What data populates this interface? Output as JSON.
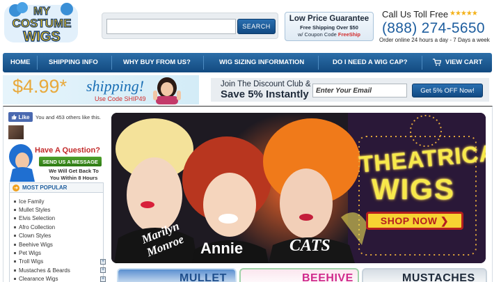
{
  "header": {
    "logo_line1": "MY",
    "logo_line2": "COSTUME",
    "logo_line3": "WIGS",
    "search": {
      "placeholder": "",
      "button_label": "SEARCH"
    },
    "guarantee": {
      "title": "Low Price Guarantee",
      "line1": "Free Shipping Over $50",
      "line2_prefix": "w/ Coupon Code ",
      "code": "FreeShip"
    },
    "phone": {
      "label": "Call Us Toll Free",
      "stars": "★★★★★",
      "number": "(888) 274-5650",
      "hours": "Order online 24 hours a day - 7 Days a week"
    }
  },
  "nav": {
    "items": [
      {
        "label": "HOME"
      },
      {
        "label": "SHIPPING INFO"
      },
      {
        "label": "WHY BUY FROM US?"
      },
      {
        "label": "WIG SIZING INFORMATION"
      },
      {
        "label": "DO I NEED A WIG CAP?"
      },
      {
        "label": "VIEW CART"
      }
    ]
  },
  "promo": {
    "shipping_price": "$4.99*",
    "shipping_word": "shipping!",
    "shipping_code": "Use Code SHIP49",
    "discount_line1": "Join The Discount Club &",
    "discount_line2": "Save 5% Instantly",
    "email_placeholder": "Enter Your Email",
    "discount_button": "Get 5% OFF Now!"
  },
  "sidebar": {
    "like_label": "Like",
    "like_text": "You and 453 others like this.",
    "question_title": "Have A Question?",
    "question_button": "SEND US A MESSAGE",
    "question_sub_line1": "We Will Get Back To",
    "question_sub_line2": "You Within 8 Hours",
    "popular_title": "MOST POPULAR",
    "popular_items": [
      {
        "label": "Ice Family",
        "expandable": false
      },
      {
        "label": "Mullet Styles",
        "expandable": false
      },
      {
        "label": "Elvis Selection",
        "expandable": false
      },
      {
        "label": "Afro Collection",
        "expandable": false
      },
      {
        "label": "Clown Styles",
        "expandable": false
      },
      {
        "label": "Beehive Wigs",
        "expandable": false
      },
      {
        "label": "Pet Wigs",
        "expandable": false
      },
      {
        "label": "Troll Wigs",
        "expandable": true
      },
      {
        "label": "Mustaches & Beards",
        "expandable": true
      },
      {
        "label": "Clearance Wigs",
        "expandable": true
      }
    ]
  },
  "hero": {
    "title_line1": "THEATRICAL",
    "title_line2": "WIGS",
    "button_label": "SHOP NOW",
    "labels": {
      "marilyn_line1": "Marilyn",
      "marilyn_line2": "Monroe",
      "annie": "Annie",
      "cats": "CATS"
    }
  },
  "tiles": [
    {
      "label": "MULLET"
    },
    {
      "label": "BEEHIVE"
    },
    {
      "label": "MUSTACHES"
    }
  ],
  "colors": {
    "brand_blue": "#1d5d9e",
    "nav_blue": "#124a80",
    "accent_red": "#d22a2a",
    "star_gold": "#f4b21a"
  }
}
